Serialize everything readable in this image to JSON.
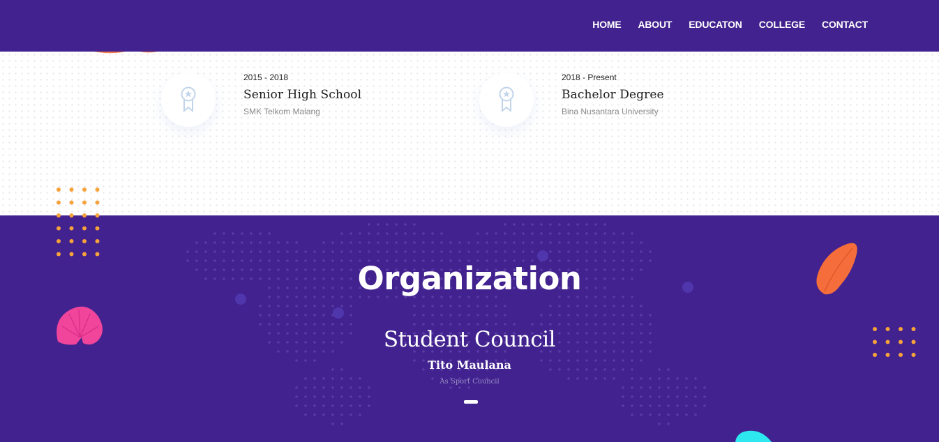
{
  "nav": {
    "items": [
      "HOME",
      "ABOUT",
      "EDUCATON",
      "COLLEGE",
      "CONTACT"
    ]
  },
  "education": {
    "items": [
      {
        "years": "2015 - 2018",
        "title": "Senior High School",
        "school": "SMK Telkom Malang",
        "icon": "award-ribbon-icon"
      },
      {
        "years": "2018 - Present",
        "title": "Bachelor Degree",
        "school": "Bina Nusantara University",
        "icon": "award-ribbon-icon"
      }
    ]
  },
  "organization": {
    "heading": "Organization",
    "name": "Student Council",
    "person": "Tito Maulana",
    "role": "As Sport Council"
  },
  "colors": {
    "primary_purple": "#41228e",
    "accent_orange": "#f7a23a",
    "blob_pink": "#f0459b",
    "leaf_orange": "#f56d3b",
    "blob_cyan": "#2ee8f0"
  }
}
